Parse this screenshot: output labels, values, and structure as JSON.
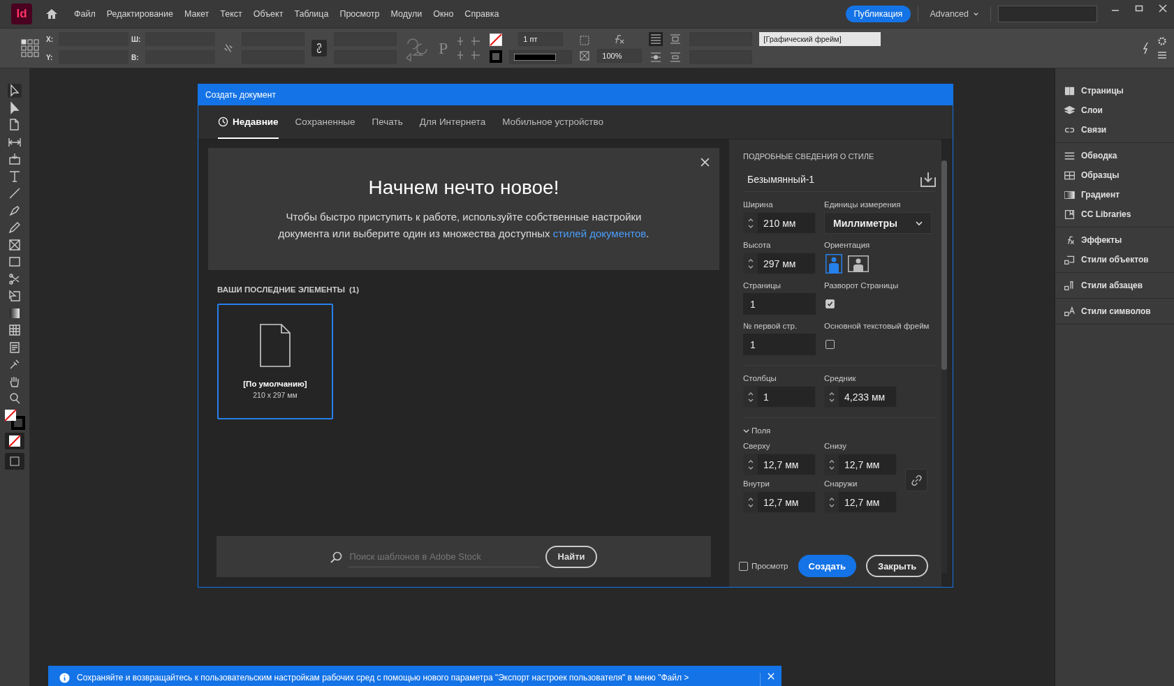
{
  "app": {
    "logo": "Id",
    "menu": [
      "Файл",
      "Редактирование",
      "Макет",
      "Текст",
      "Объект",
      "Таблица",
      "Просмотр",
      "Модули",
      "Окно",
      "Справка"
    ],
    "publish_button": "Публикация",
    "workspace": "Advanced"
  },
  "control_bar": {
    "x_label": "X:",
    "y_label": "Y:",
    "w_label": "Ш:",
    "h_label": "В:",
    "paragraph_glyph": "P",
    "stroke_weight": "1 пт",
    "scale": "100%",
    "frame_style": "[Графический фрейм]"
  },
  "dialog": {
    "title": "Создать документ",
    "tabs": [
      {
        "label": "Недавние",
        "selected": true
      },
      {
        "label": "Сохраненные",
        "selected": false
      },
      {
        "label": "Печать",
        "selected": false
      },
      {
        "label": "Для Интернета",
        "selected": false
      },
      {
        "label": "Мобильное устройство",
        "selected": false
      }
    ],
    "hero": {
      "title": "Начнем нечто новое!",
      "text": "Чтобы быстро приступить к работе, используйте собственные настройки документа или выберите один из множества доступных ",
      "link": "стилей документов",
      "text_end": "."
    },
    "recent": {
      "heading": "ВАШИ ПОСЛЕДНИЕ ЭЛЕМЕНТЫ",
      "count": "(1)",
      "items": [
        {
          "name": "[По умолчанию]",
          "size": "210 x 297 мм",
          "selected": true
        }
      ]
    },
    "search": {
      "placeholder": "Поиск шаблонов в Adobe Stock",
      "button": "Найти"
    },
    "details": {
      "heading": "ПОДРОБНЫЕ СВЕДЕНИЯ О СТИЛЕ",
      "preset_name": "Безымянный-1",
      "width_label": "Ширина",
      "width": "210 мм",
      "units_label": "Единицы измерения",
      "units": "Миллиметры",
      "height_label": "Высота",
      "height": "297 мм",
      "orientation_label": "Ориентация",
      "orientation": [
        {
          "kind": "portrait",
          "selected": true
        },
        {
          "kind": "landscape",
          "selected": false
        }
      ],
      "pages_label": "Страницы",
      "pages": "1",
      "facing_label": "Разворот Страницы",
      "facing_checked": true,
      "first_page_label": "№ первой стр.",
      "first_page": "1",
      "primary_frame_label": "Основной текстовый фрейм",
      "primary_frame_checked": false,
      "columns_label": "Столбцы",
      "columns": "1",
      "gutter_label": "Средник",
      "gutter": "4,233 мм",
      "margins": {
        "label": "Поля",
        "expanded": true,
        "fields": [
          {
            "label": "Сверху",
            "value": "12,7 мм"
          },
          {
            "label": "Снизу",
            "value": "12,7 мм"
          },
          {
            "label": "Внутри",
            "value": "12,7 мм"
          },
          {
            "label": "Снаружи",
            "value": "12,7 мм"
          }
        ]
      },
      "preview_label": "Просмотр",
      "preview_checked": false,
      "create_button": "Создать",
      "close_button": "Закрыть"
    }
  },
  "panels": [
    [
      {
        "label": "Страницы",
        "kind": "pages"
      },
      {
        "label": "Слои",
        "kind": "layers"
      },
      {
        "label": "Связи",
        "kind": "links"
      }
    ],
    [
      {
        "label": "Обводка",
        "kind": "stroke"
      },
      {
        "label": "Образцы",
        "kind": "swatches"
      },
      {
        "label": "Градиент",
        "kind": "gradient"
      },
      {
        "label": "CC Libraries",
        "kind": "libraries"
      }
    ],
    [
      {
        "label": "Эффекты",
        "kind": "effects"
      },
      {
        "label": "Стили объектов",
        "kind": "objstyles"
      }
    ],
    [
      {
        "label": "Стили абзацев",
        "kind": "parastyles"
      }
    ],
    [
      {
        "label": "Стили символов",
        "kind": "charstyles"
      }
    ]
  ],
  "notification": {
    "text": "Сохраняйте и возвращайтесь к пользовательским настройкам рабочих сред с помощью нового параметра \"Экспорт настроек пользователя\" в меню \"Файл >"
  }
}
